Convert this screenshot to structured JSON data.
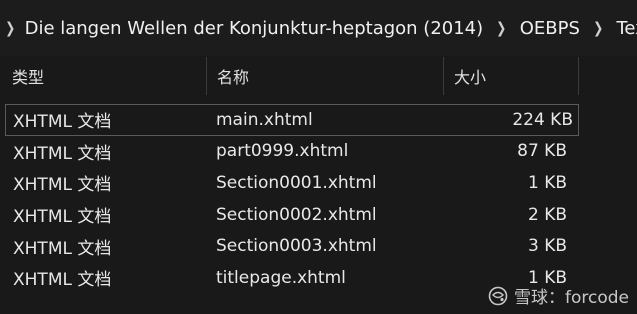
{
  "breadcrumb": {
    "items": [
      "Die langen Wellen der Konjunktur-heptagon (2014)",
      "OEBPS",
      "Text"
    ]
  },
  "columns": {
    "type": "类型",
    "name": "名称",
    "size": "大小"
  },
  "files": [
    {
      "type": "XHTML 文档",
      "name": "main.xhtml",
      "size": "224 KB"
    },
    {
      "type": "XHTML 文档",
      "name": "part0999.xhtml",
      "size": "87 KB"
    },
    {
      "type": "XHTML 文档",
      "name": "Section0001.xhtml",
      "size": "1 KB"
    },
    {
      "type": "XHTML 文档",
      "name": "Section0002.xhtml",
      "size": "2 KB"
    },
    {
      "type": "XHTML 文档",
      "name": "Section0003.xhtml",
      "size": "3 KB"
    },
    {
      "type": "XHTML 文档",
      "name": "titlepage.xhtml",
      "size": "1 KB"
    }
  ],
  "watermark": {
    "text": "雪球：forcode"
  }
}
